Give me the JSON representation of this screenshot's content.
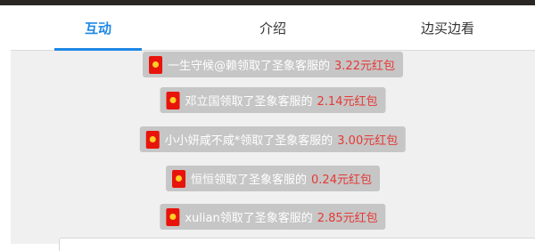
{
  "tabs": [
    {
      "label": "互动"
    },
    {
      "label": "介绍"
    },
    {
      "label": "边买边看"
    }
  ],
  "feed": [
    {
      "text": "一生守候@赖领取了圣象客服的",
      "amount": "3.22元红包"
    },
    {
      "text": "邓立国领取了圣象客服的",
      "amount": "2.14元红包"
    },
    {
      "text": "小小妍咸不咸*领取了圣象客服的",
      "amount": "3.00元红包"
    },
    {
      "text": "恒恒领取了圣象客服的",
      "amount": "0.24元红包"
    },
    {
      "text": "xulian领取了圣象客服的",
      "amount": "2.85元红包"
    }
  ],
  "colors": {
    "accent": "#1e88e5",
    "amount": "#e53935",
    "envelope": "#e8140b"
  }
}
